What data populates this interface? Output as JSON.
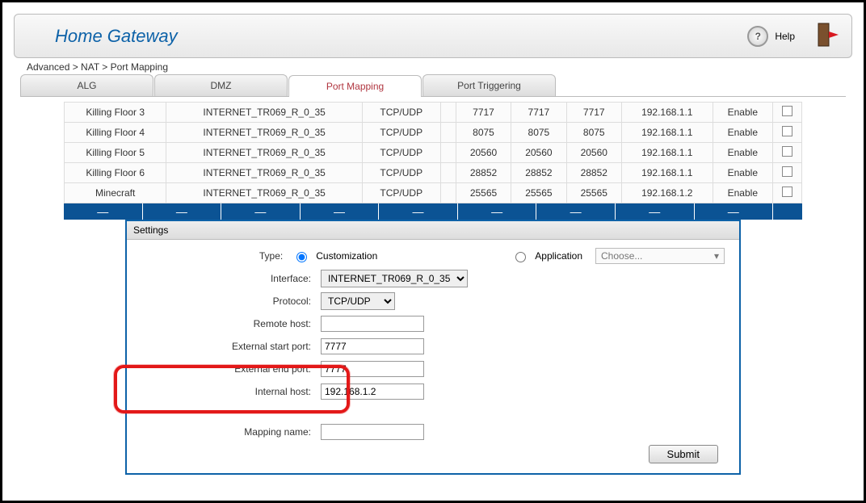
{
  "header": {
    "title": "Home Gateway",
    "help": "Help"
  },
  "breadcrumb": "Advanced > NAT > Port Mapping",
  "tabs": [
    "ALG",
    "DMZ",
    "Port Mapping",
    "Port Triggering"
  ],
  "active_tab": 2,
  "rows": [
    {
      "name": "Killing Floor 3",
      "iface": "INTERNET_TR069_R_0_35",
      "proto": "TCP/UDP",
      "c1": "",
      "c2": "7717",
      "c3": "7717",
      "c4": "7717",
      "host": "192.168.1.1",
      "status": "Enable"
    },
    {
      "name": "Killing Floor 4",
      "iface": "INTERNET_TR069_R_0_35",
      "proto": "TCP/UDP",
      "c1": "",
      "c2": "8075",
      "c3": "8075",
      "c4": "8075",
      "host": "192.168.1.1",
      "status": "Enable"
    },
    {
      "name": "Killing Floor 5",
      "iface": "INTERNET_TR069_R_0_35",
      "proto": "TCP/UDP",
      "c1": "",
      "c2": "20560",
      "c3": "20560",
      "c4": "20560",
      "host": "192.168.1.1",
      "status": "Enable"
    },
    {
      "name": "Killing Floor 6",
      "iface": "INTERNET_TR069_R_0_35",
      "proto": "TCP/UDP",
      "c1": "",
      "c2": "28852",
      "c3": "28852",
      "c4": "28852",
      "host": "192.168.1.1",
      "status": "Enable"
    },
    {
      "name": "Minecraft",
      "iface": "INTERNET_TR069_R_0_35",
      "proto": "TCP/UDP",
      "c1": "",
      "c2": "25565",
      "c3": "25565",
      "c4": "25565",
      "host": "192.168.1.2",
      "status": "Enable"
    }
  ],
  "settings": {
    "panel_title": "Settings",
    "labels": {
      "type": "Type:",
      "interface": "Interface:",
      "protocol": "Protocol:",
      "remote": "Remote host:",
      "ext_start": "External start port:",
      "ext_end": "External end port:",
      "int_host": "Internal host:",
      "mapping": "Mapping name:"
    },
    "type_customization": "Customization",
    "type_application": "Application",
    "app_placeholder": "Choose...",
    "interface_value": "INTERNET_TR069_R_0_35",
    "protocol_value": "TCP/UDP",
    "remote_value": "",
    "ext_start_value": "7777",
    "ext_end_value": "7777",
    "int_host_value": "192.168.1.2",
    "mapping_value": "",
    "submit": "Submit"
  }
}
